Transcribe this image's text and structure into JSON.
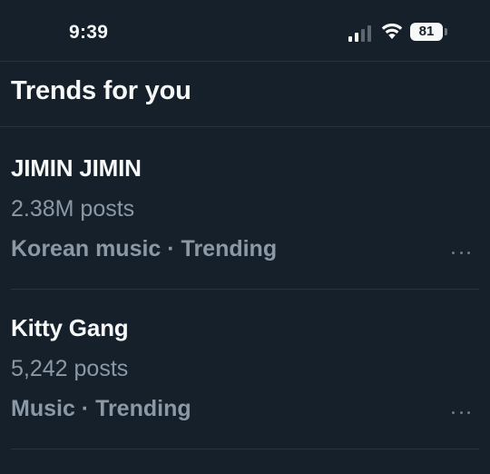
{
  "status_bar": {
    "time": "9:39",
    "battery_level": "81",
    "icons": [
      "cellular-signal-icon",
      "wifi-icon",
      "battery-icon"
    ]
  },
  "header": {
    "title": "Trends for you"
  },
  "trends": [
    {
      "name": "JIMIN JIMIN",
      "post_count": "2.38M posts",
      "meta": "Korean music · Trending"
    },
    {
      "name": "Kitty Gang",
      "post_count": "5,242 posts",
      "meta": "Music · Trending"
    }
  ],
  "colors": {
    "background": "#15202b",
    "primary_text": "#f7f9f9",
    "secondary_text": "#8b98a5",
    "divider": "#263340"
  }
}
